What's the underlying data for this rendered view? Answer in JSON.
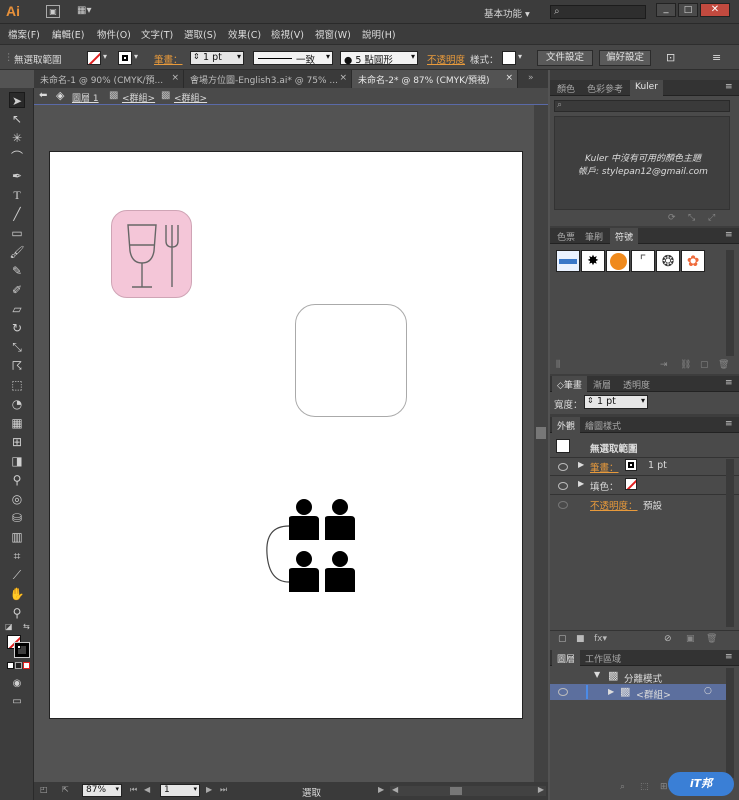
{
  "app": {
    "logo": "Ai",
    "workspace": "基本功能",
    "search_placeholder": ""
  },
  "menu": [
    "檔案(F)",
    "編輯(E)",
    "物件(O)",
    "文字(T)",
    "選取(S)",
    "效果(C)",
    "檢視(V)",
    "視窗(W)",
    "說明(H)"
  ],
  "control": {
    "selection_status": "無選取範圍",
    "stroke_label": "筆畫：",
    "stroke_weight": "1 pt",
    "profile": "一致",
    "brush": "5 點圓形",
    "opacity_label": "不透明度",
    "style_label": "樣式：",
    "doc_setup": "文件設定",
    "preferences": "偏好設定"
  },
  "doc_tabs": [
    "未命名-1 @ 90% (CMYK/預...",
    "會場方位圖-English3.ai* @ 75% ...",
    "未命名-2* @ 87% (CMYK/預視)"
  ],
  "breadcrumb": {
    "layer": "圖層 1",
    "group1": "<群組>",
    "group2": "<群組>"
  },
  "status": {
    "zoom": "87%",
    "page": "1",
    "tool": "選取"
  },
  "panels": {
    "color_tabs": [
      "顏色",
      "色彩參考",
      "Kuler"
    ],
    "kuler_message": "Kuler 中沒有可用的顏色主題",
    "kuler_user": "帳戶: stylepan12@gmail.com",
    "swatch_tabs": [
      "色票",
      "筆刷",
      "符號"
    ],
    "stroke_tabs": [
      "筆畫",
      "漸層",
      "透明度"
    ],
    "weight_label": "寬度：",
    "weight_value": "1 pt",
    "appearance_tabs": [
      "外觀",
      "繪圖樣式"
    ],
    "appearance": {
      "title": "無選取範圍",
      "stroke_label": "筆畫：",
      "stroke_value": "1 pt",
      "fill_label": "填色：",
      "opacity_label": "不透明度：",
      "opacity_value": "預設"
    },
    "layer_tabs": [
      "圖層",
      "工作區域"
    ],
    "layers": [
      {
        "name": "分離模式"
      },
      {
        "name": "<群組>"
      }
    ]
  },
  "colors": {
    "accent": "#e89a3b",
    "pink_tile": "#f4c6d8",
    "canvas_bg": "#535353",
    "panel_bg": "#3d3d3d"
  }
}
